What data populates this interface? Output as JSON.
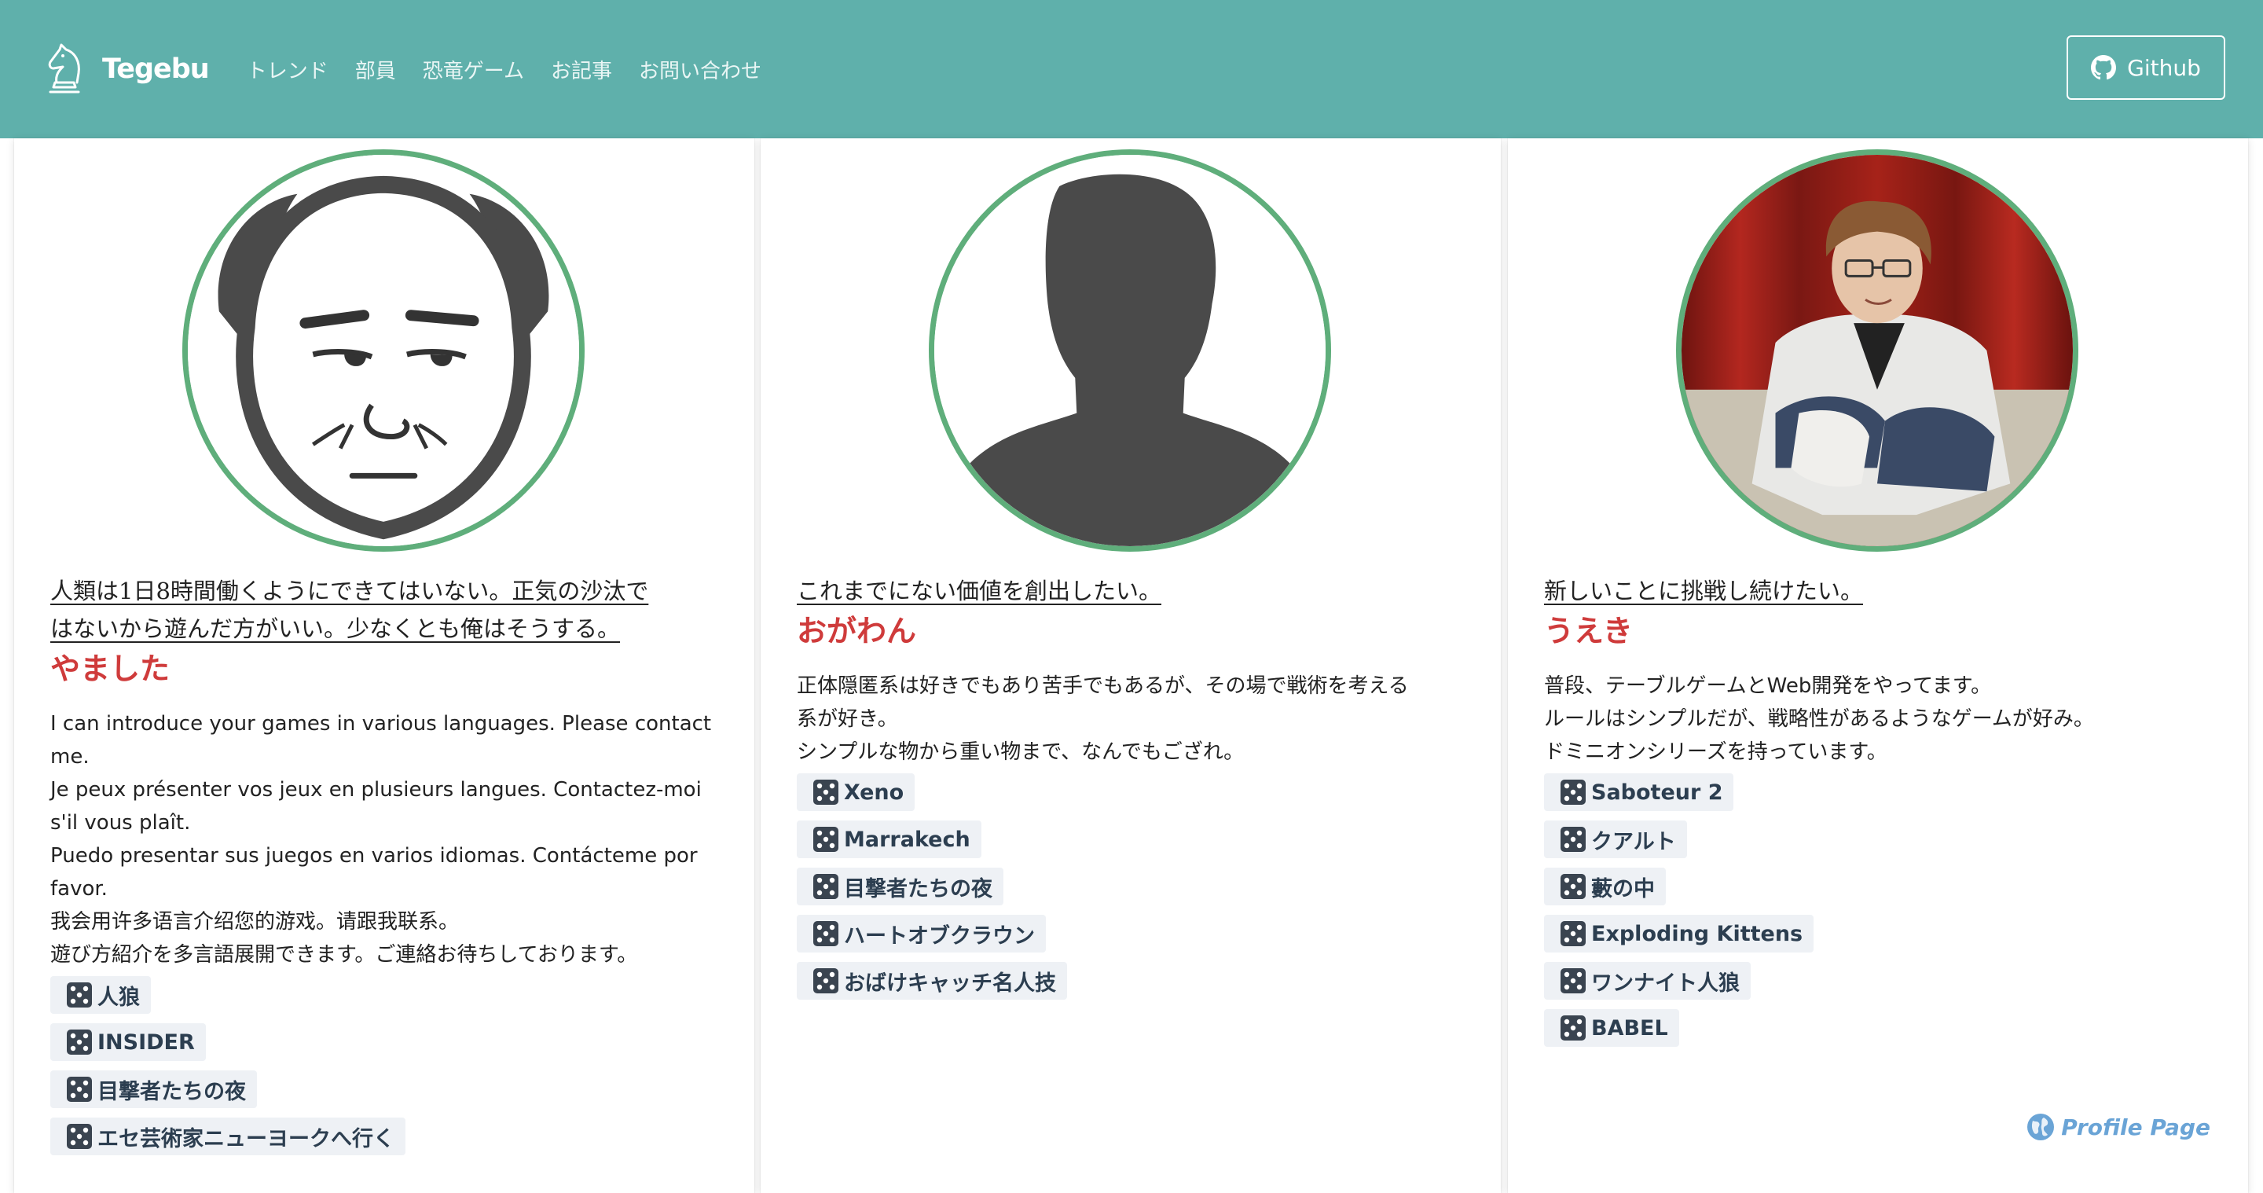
{
  "nav": {
    "brand": "Tegebu",
    "links": [
      "トレンド",
      "部員",
      "恐竜ゲーム",
      "お記事",
      "お問い合わせ"
    ],
    "github": "Github",
    "bg_color": "#5fb0ab"
  },
  "members": [
    {
      "quote_lines": [
        "人類は1日8時間働くようにできてはいない。正気の沙汰で",
        "はないから遊んだ方がいい。少なくとも俺はそうする。"
      ],
      "name": "やました",
      "desc": [
        "I can introduce your games in various languages. Please contact",
        "me.",
        "Je peux présenter vos jeux en plusieurs langues. Contactez-moi",
        "s'il vous plaît.",
        "Puedo presentar sus juegos en varios idiomas. Contácteme por",
        "favor.",
        "我会用许多语言介绍您的游戏。请跟我联系。",
        "遊び方紹介を多言語展開できます。ご連絡お待ちしております。"
      ],
      "games": [
        "人狼",
        "INSIDER",
        "目撃者たちの夜",
        "エセ芸術家ニューヨークへ行く"
      ],
      "avatar_icon": "bald-man-illustration"
    },
    {
      "quote_lines": [
        "これまでにない価値を創出したい。"
      ],
      "name": "おがわん",
      "desc": [
        "正体隠匿系は好きでもあり苦手でもあるが、その場で戦術を考える",
        "系が好き。",
        "シンプルな物から重い物まで、なんでもござれ。"
      ],
      "games": [
        "Xeno",
        "Marrakech",
        "目撃者たちの夜",
        "ハートオブクラウン",
        "おばけキャッチ名人技"
      ],
      "avatar_icon": "silhouette-placeholder"
    },
    {
      "quote_lines": [
        "新しいことに挑戦し続けたい。"
      ],
      "name": "うえき",
      "desc": [
        "普段、テーブルゲームとWeb開発をやってます。",
        "ルールはシンプルだが、戦略性があるようなゲームが好み。",
        "ドミニオンシリーズを持っています。"
      ],
      "games": [
        "Saboteur 2",
        "クアルト",
        "藪の中",
        "Exploding Kittens",
        "ワンナイト人狼",
        "BABEL"
      ],
      "avatar_icon": "person-photo",
      "profile_link": "Profile Page"
    }
  ],
  "colors": {
    "accent_name": "#cf3b3b",
    "avatar_border": "#5fae7b",
    "tag_bg": "#eef1f5",
    "profile_link": "#6aa4d6"
  }
}
